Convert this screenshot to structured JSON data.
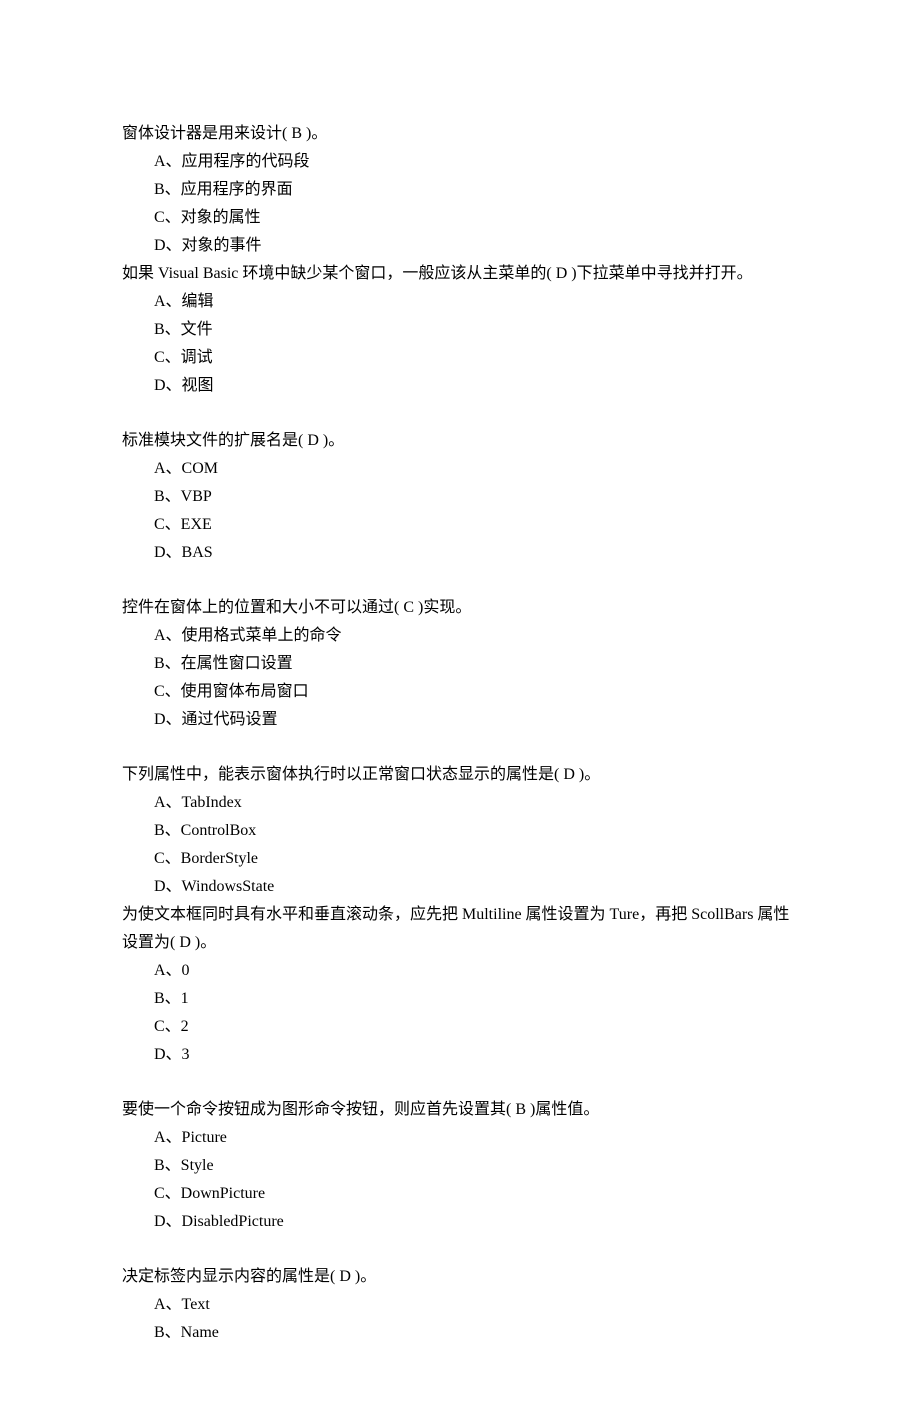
{
  "questions": [
    {
      "text": "窗体设计器是用来设计( B    )。",
      "options": [
        "A、应用程序的代码段",
        "B、应用程序的界面",
        "C、对象的属性",
        "D、对象的事件"
      ],
      "gap_after": false
    },
    {
      "text": "如果 Visual Basic 环境中缺少某个窗口，一般应该从主菜单的( D    )下拉菜单中寻找并打开。",
      "options": [
        "A、编辑",
        "B、文件",
        "C、调试",
        "D、视图"
      ],
      "gap_after": true
    },
    {
      "text": "标准模块文件的扩展名是( D    )。",
      "options": [
        "A、COM",
        "B、VBP",
        "C、EXE",
        "D、BAS"
      ],
      "gap_after": true
    },
    {
      "text": "控件在窗体上的位置和大小不可以通过( C    )实现。",
      "options": [
        "A、使用格式菜单上的命令",
        "B、在属性窗口设置",
        "C、使用窗体布局窗口",
        "D、通过代码设置"
      ],
      "gap_after": true
    },
    {
      "text": "下列属性中，能表示窗体执行时以正常窗口状态显示的属性是( D    )。",
      "options": [
        "A、TabIndex",
        "B、ControlBox",
        "C、BorderStyle",
        "D、WindowsState"
      ],
      "gap_after": false
    },
    {
      "text": "为使文本框同时具有水平和垂直滚动条，应先把 Multiline 属性设置为 Ture，再把 ScollBars 属性设置为( D    )。",
      "options": [
        "A、0",
        "B、1",
        "C、2",
        "D、3"
      ],
      "gap_after": true
    },
    {
      "text": "要使一个命令按钮成为图形命令按钮，则应首先设置其(    B )属性值。",
      "options": [
        "A、Picture",
        "B、Style",
        "C、DownPicture",
        "D、DisabledPicture"
      ],
      "gap_after": true
    },
    {
      "text": "决定标签内显示内容的属性是( D    )。",
      "options": [
        "A、Text",
        "B、Name"
      ],
      "gap_after": false
    }
  ]
}
